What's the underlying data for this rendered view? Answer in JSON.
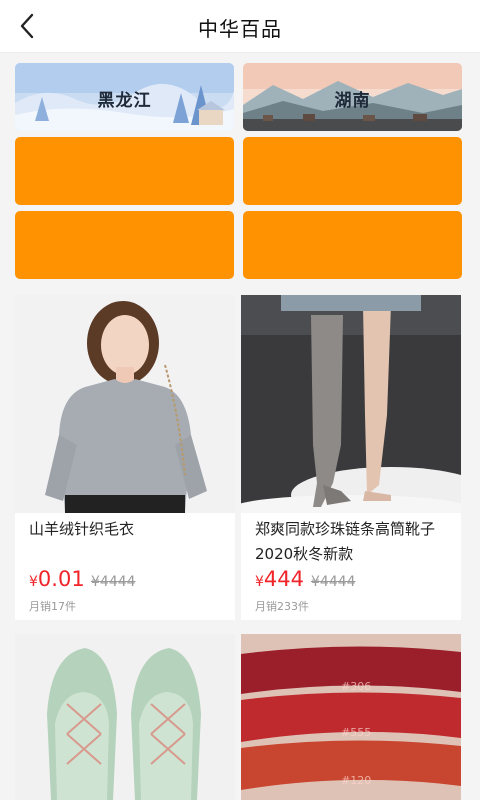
{
  "header": {
    "title": "中华百品"
  },
  "regions": [
    {
      "label": "黑龙江"
    },
    {
      "label": "湖南"
    }
  ],
  "colors": {
    "accent": "#ff9200",
    "price": "#f0252a"
  },
  "products": [
    {
      "name": "山羊绒针织毛衣",
      "currency": "¥",
      "price": "0.01",
      "original_price": "¥4444",
      "sales": "月销17件"
    },
    {
      "name": "郑爽同款珍珠链条高筒靴子2020秋冬新款",
      "currency": "¥",
      "price": "444",
      "original_price": "¥4444",
      "sales": "月销233件"
    },
    {
      "name": "",
      "currency": "",
      "price": "",
      "original_price": "",
      "sales": ""
    },
    {
      "name": "",
      "currency": "",
      "price": "",
      "original_price": "",
      "sales": "",
      "swatch_labels": [
        "#306",
        "#555",
        "#120"
      ]
    }
  ]
}
